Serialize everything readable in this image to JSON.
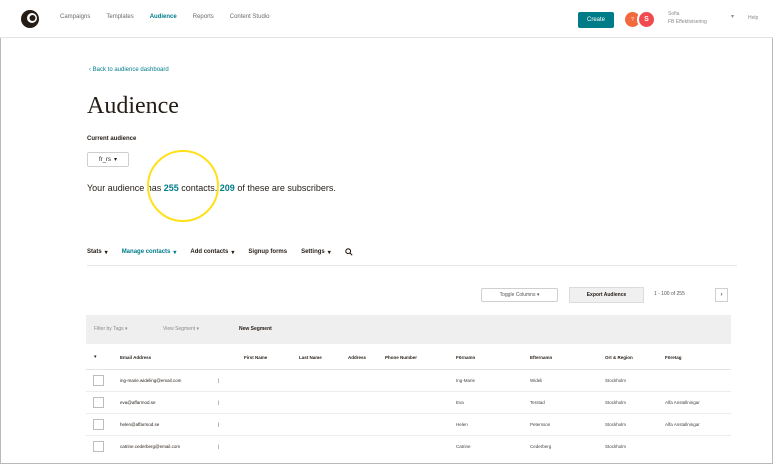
{
  "topnav": {
    "links": [
      "Campaigns",
      "Templates",
      "Audience",
      "Reports",
      "Content Studio"
    ],
    "active_index": 2,
    "create_label": "Create",
    "badge_label": "?",
    "avatar_initial": "S",
    "account_name": "Sofia",
    "account_org": "FB Effektivisering",
    "help_label": "Help",
    "brand_color": "#007c89"
  },
  "header": {
    "back_link": "‹  Back to audience dashboard",
    "title": "Audience",
    "current_audience_label": "Current audience",
    "audience_value": "fr_rs"
  },
  "summary": {
    "prefix": "Your audience has ",
    "contacts": "255",
    "middle": " contacts. ",
    "subscribers": "209",
    "suffix": " of these are subscribers."
  },
  "subnav": {
    "items": [
      "Stats",
      "Manage contacts",
      "Add contacts",
      "Signup forms",
      "Settings"
    ],
    "active_index": 1
  },
  "toolbar": {
    "toggle_columns": "Toggle Columns",
    "export": "Export Audience",
    "pager": "1 - 100 of 255",
    "next": "›"
  },
  "filters": {
    "filter_by_tags": "Filter by Tags",
    "view_segment": "View Segment",
    "new_segment": "New Segment"
  },
  "table": {
    "columns": [
      "Email Address",
      "First Name",
      "Last Name",
      "Address",
      "Phone Number",
      "Förnamn",
      "Efternamn",
      "Ort & Region",
      "Företag"
    ],
    "rows": [
      {
        "email": "ing-marie.wideling@email.com",
        "fornamn": "Ing-Marie",
        "efternamn": "Wideli",
        "ort": "Stockholm",
        "foretag": ""
      },
      {
        "email": "eva@affarmod.se",
        "fornamn": "Eva",
        "efternamn": "Terstad",
        "ort": "Stockholm",
        "foretag": "Alfa Anstallningar"
      },
      {
        "email": "helen@affarmod.se",
        "fornamn": "Helen",
        "efternamn": "Petersson",
        "ort": "Stockholm",
        "foretag": "Alfa Anstallningar"
      },
      {
        "email": "catrine.cederberg@email.com",
        "fornamn": "Catrine",
        "efternamn": "Cederberg",
        "ort": "Stockholm",
        "foretag": ""
      }
    ]
  }
}
